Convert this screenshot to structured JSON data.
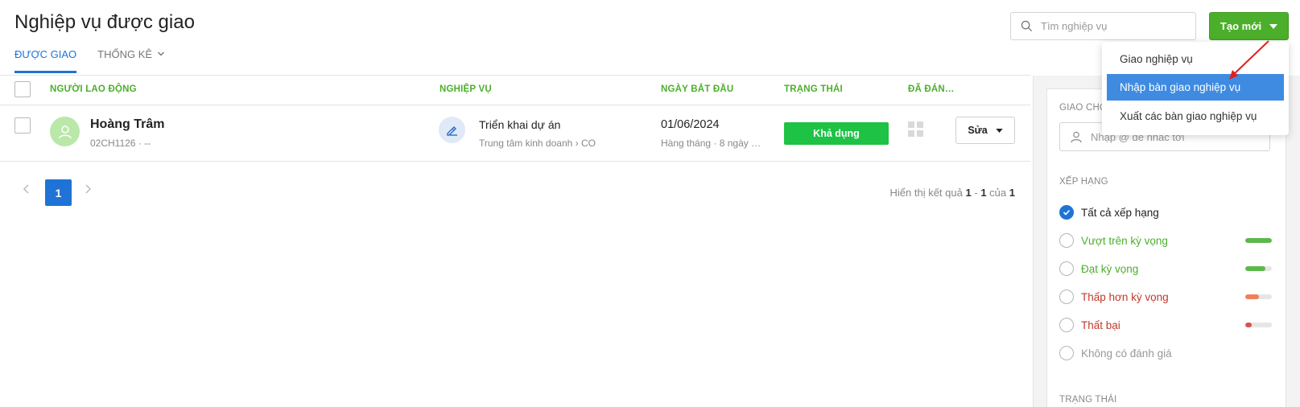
{
  "header": {
    "title": "Nghiệp vụ được giao",
    "search_placeholder": "Tìm nghiệp vụ",
    "create_label": "Tạo mới"
  },
  "tabs": [
    {
      "label": "ĐƯỢC GIAO",
      "active": true
    },
    {
      "label": "THỐNG KÊ",
      "active": false
    }
  ],
  "dropdown": {
    "items": [
      {
        "label": "Giao nghiệp vụ",
        "highlighted": false
      },
      {
        "label": "Nhập bàn giao nghiệp vụ",
        "highlighted": true
      },
      {
        "label": "Xuất các bàn giao nghiệp vụ",
        "highlighted": false
      }
    ]
  },
  "table": {
    "columns": [
      "NGƯỜI LAO ĐỘNG",
      "NGHIỆP VỤ",
      "NGÀY BẮT ĐẦU",
      "TRẠNG THÁI",
      "ĐÃ ĐÁN…"
    ],
    "rows": [
      {
        "employee_name": "Hoàng Trâm",
        "employee_sub": "02CH1126 · --",
        "task_name": "Triển khai dự án",
        "task_sub": "Trung tâm kinh doanh › CO",
        "start_date": "01/06/2024",
        "date_sub": "Hàng tháng · 8 ngày …",
        "status": "Khả dụng",
        "edit_label": "Sửa"
      }
    ]
  },
  "pagination": {
    "current_page": "1",
    "result_prefix": "Hiển thị kết quả",
    "from": "1",
    "sep": "-",
    "to": "1",
    "of_word": "của",
    "total": "1"
  },
  "sidebar": {
    "assign_label": "GIAO CHO",
    "mention_placeholder": "Nhập @ để nhắc tới",
    "rating_label": "XẾP HẠNG",
    "ratings": [
      {
        "label": "Tất cả xếp hạng",
        "checked": true,
        "color": "#222222"
      },
      {
        "label": "Vượt trên kỳ vọng",
        "checked": false,
        "color": "#4caf2b",
        "bar_fraction": 1.0,
        "bar_color": "#5cb84a"
      },
      {
        "label": "Đạt kỳ vọng",
        "checked": false,
        "color": "#4caf2b",
        "bar_fraction": 0.75,
        "bar_color": "#5cb84a"
      },
      {
        "label": "Thấp hơn kỳ vọng",
        "checked": false,
        "color": "#c0392b",
        "bar_fraction": 0.5,
        "bar_color": "#f07f5a"
      },
      {
        "label": "Thất bại",
        "checked": false,
        "color": "#c0392b",
        "bar_fraction": 0.25,
        "bar_color": "#d9534f"
      },
      {
        "label": "Không có đánh giá",
        "checked": false,
        "color": "#999999"
      }
    ],
    "status_label": "TRẠNG THÁI"
  },
  "colors": {
    "accent_blue": "#1f73d6",
    "accent_green": "#4caf2b",
    "status_green": "#1ec245"
  }
}
